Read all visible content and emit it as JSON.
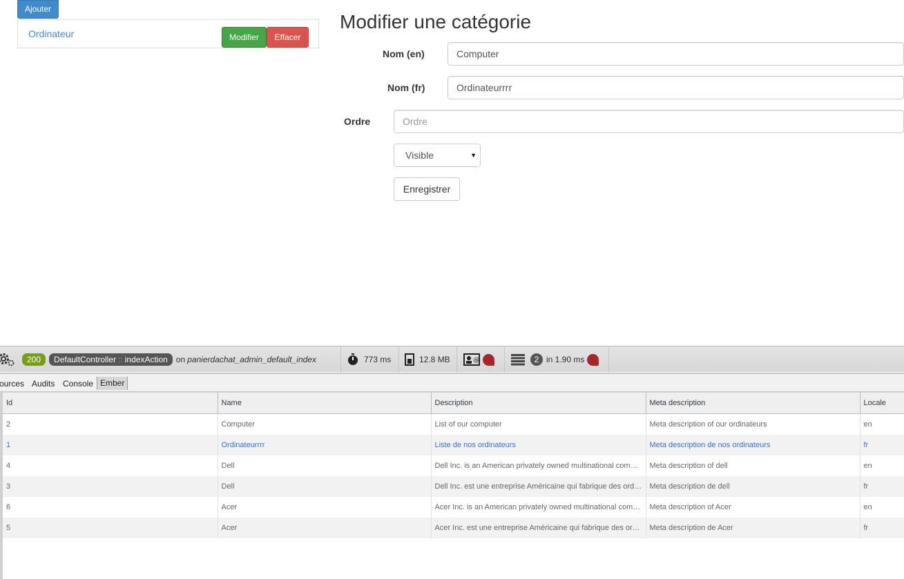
{
  "list": {
    "add_label": "Ajouter",
    "items": [
      {
        "name": "Ordinateur",
        "edit_label": "Modifier",
        "delete_label": "Effacer"
      }
    ]
  },
  "form": {
    "title": "Modifier une catégorie",
    "name_en_label": "Nom (en)",
    "name_en_value": "Computer",
    "name_fr_label": "Nom (fr)",
    "name_fr_value": "Ordinateurrrr",
    "order_label": "Ordre",
    "order_placeholder": "Ordre",
    "visibility_value": "Visible",
    "save_label": "Enregistrer"
  },
  "toolbar": {
    "status_code": "200",
    "controller": "DefaultController",
    "action_sep": "::",
    "action": "indexAction",
    "route_prefix": "on",
    "route": "panierdachat_admin_default_index",
    "time": "773 ms",
    "memory": "12.8 MB",
    "db_queries": "2",
    "db_time": "in 1.90 ms"
  },
  "devtools": {
    "tabs": [
      "ources",
      "Audits",
      "Console",
      "Ember"
    ],
    "active_tab": "Ember"
  },
  "table": {
    "columns": [
      "Id",
      "Name",
      "Description",
      "Meta description",
      "Locale"
    ],
    "rows": [
      [
        "2",
        "Computer",
        "List of our computer",
        "Meta description of our ordinateurs",
        "en"
      ],
      [
        "1",
        "Ordinateurrrr",
        "Liste de nos ordinateurs",
        "Meta description de nos ordinateurs",
        "fr"
      ],
      [
        "4",
        "Dell",
        "Dell Inc. is an American privately owned multinational computer",
        "Meta description of dell",
        "en"
      ],
      [
        "3",
        "Dell",
        "Dell Inc. est une entreprise Américaine qui fabrique des ordinateurs",
        "Meta description de dell",
        "fr"
      ],
      [
        "6",
        "Acer",
        "Acer Inc. is an American privately owned multinational computer",
        "Meta description of Acer",
        "en"
      ],
      [
        "5",
        "Acer",
        "Acer Inc. est une entreprise Américaine qui fabrique des ordinateurs",
        "Meta description de Acer",
        "fr"
      ]
    ],
    "selected_row": 1
  },
  "colors": {
    "primary": "#428bca",
    "success": "#47a447",
    "danger": "#d9534f",
    "status_ok": "#759e1a",
    "error_blob": "#a7262c",
    "selected_text": "#3a6fd8"
  },
  "icons": [
    "gear-icon",
    "stopwatch-icon",
    "memory-icon",
    "security-icon",
    "database-icon",
    "chevron-down-icon"
  ]
}
